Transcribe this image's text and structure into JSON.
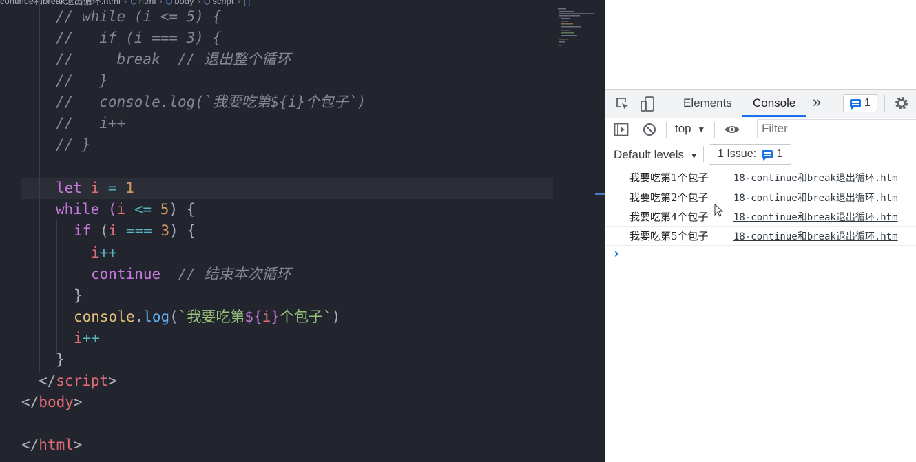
{
  "editor": {
    "breadcrumb": [
      "continue和break退出循环.html",
      "html",
      "body",
      "script",
      "[ ]"
    ],
    "code": {
      "c1": "// while (i <= 5) {",
      "c2": "//   if (i === 3) {",
      "c3a": "//     break",
      "c3b": "// 退出整个循环",
      "c4": "//   }",
      "c5": "//   console.log(`我要吃第${i}个包子`)",
      "c6": "//   i++",
      "c7": "// }",
      "let": "let",
      "var_i": "i",
      "eq": "=",
      "one": "1",
      "while": "while",
      "lparen": "(",
      "le": "<=",
      "five": "5",
      "rparen_brace": ") {",
      "if": "if",
      "strict_eq": "===",
      "three": "3",
      "plusplus": "++",
      "continue": "continue",
      "continue_comment": "// 结束本次循环",
      "close_brace": "}",
      "console": "console",
      "dot": ".",
      "log": "log",
      "tick_open": "`我要吃第",
      "interp_open": "${",
      "interp_close": "}",
      "tick_close": "个包子`",
      "paren_close": ")",
      "lt": "<",
      "lt_slash": "</",
      "gt": ">",
      "tag_script": "script",
      "tag_body": "body",
      "tag_html": "html"
    }
  },
  "devtools": {
    "tabs": {
      "elements": "Elements",
      "console": "Console",
      "more": "»",
      "messages_count": "1"
    },
    "toolbar": {
      "context": "top",
      "filter_placeholder": "Filter"
    },
    "levels": {
      "default_levels": "Default levels",
      "issues_label": "1 Issue:",
      "issues_count": "1"
    },
    "messages": [
      {
        "text": "我要吃第1个包子",
        "source": "18-continue和break退出循环.htm"
      },
      {
        "text": "我要吃第2个包子",
        "source": "18-continue和break退出循环.htm"
      },
      {
        "text": "我要吃第4个包子",
        "source": "18-continue和break退出循环.htm"
      },
      {
        "text": "我要吃第5个包子",
        "source": "18-continue和break退出循环.htm"
      }
    ],
    "prompt": "›"
  },
  "colors": {
    "editor_bg": "#23252e",
    "keyword": "#c678dd",
    "variable": "#e06c75",
    "number": "#d19a66",
    "string": "#98c379",
    "comment": "#838896",
    "accent": "#1a73e8"
  }
}
